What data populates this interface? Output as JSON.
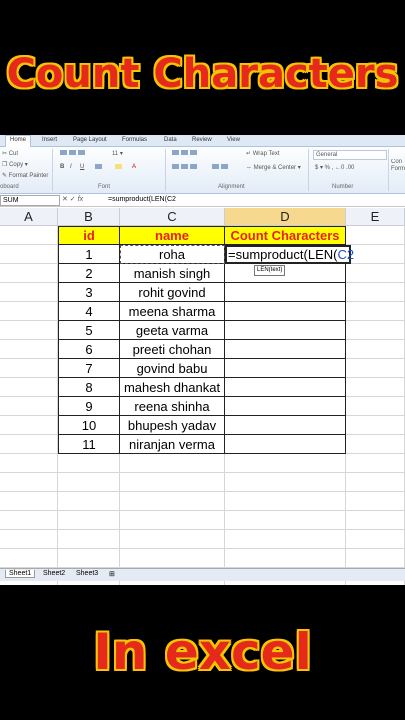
{
  "banner_top": "Count Characters",
  "banner_bottom": "In excel",
  "ribbon": {
    "tabs": [
      "Home",
      "Insert",
      "Page Layout",
      "Formulas",
      "Data",
      "Review",
      "View"
    ],
    "clipboard": {
      "cut": "Cut",
      "copy": "Copy",
      "format_painter": "Format Painter",
      "group": "oboard"
    },
    "font": {
      "size": "11",
      "group": "Font"
    },
    "alignment": {
      "wrap": "Wrap Text",
      "merge": "Merge & Center",
      "group": "Alignment"
    },
    "number": {
      "format": "General",
      "group": "Number"
    },
    "styles": {
      "cond": "Con Form"
    }
  },
  "formula_bar": {
    "name_box": "SUM",
    "fx": "fx",
    "formula": "=sumproduct(LEN(C2"
  },
  "columns": [
    "A",
    "B",
    "C",
    "D",
    "E"
  ],
  "header_row": {
    "id": "id",
    "name": "name",
    "count": "Count Characters"
  },
  "rows": [
    {
      "id": "1",
      "name": "roha"
    },
    {
      "id": "2",
      "name": "manish singh"
    },
    {
      "id": "3",
      "name": "rohit govind"
    },
    {
      "id": "4",
      "name": "meena sharma"
    },
    {
      "id": "5",
      "name": "geeta varma"
    },
    {
      "id": "6",
      "name": "preeti chohan"
    },
    {
      "id": "7",
      "name": "govind babu"
    },
    {
      "id": "8",
      "name": "mahesh dhankat"
    },
    {
      "id": "9",
      "name": "reena shinha"
    },
    {
      "id": "10",
      "name": "bhupesh yadav"
    },
    {
      "id": "11",
      "name": "niranjan verma"
    }
  ],
  "active_cell_formula": "=sumproduct(LEN(C2",
  "tooltip": "LEN(text)",
  "sheet_tabs": [
    "Sheet1",
    "Sheet2",
    "Sheet3"
  ],
  "colors": {
    "banner_text": "#e52a1c",
    "banner_outline": "#f6c400",
    "header_fill": "#ffff00",
    "header_text": "#e8201c"
  }
}
